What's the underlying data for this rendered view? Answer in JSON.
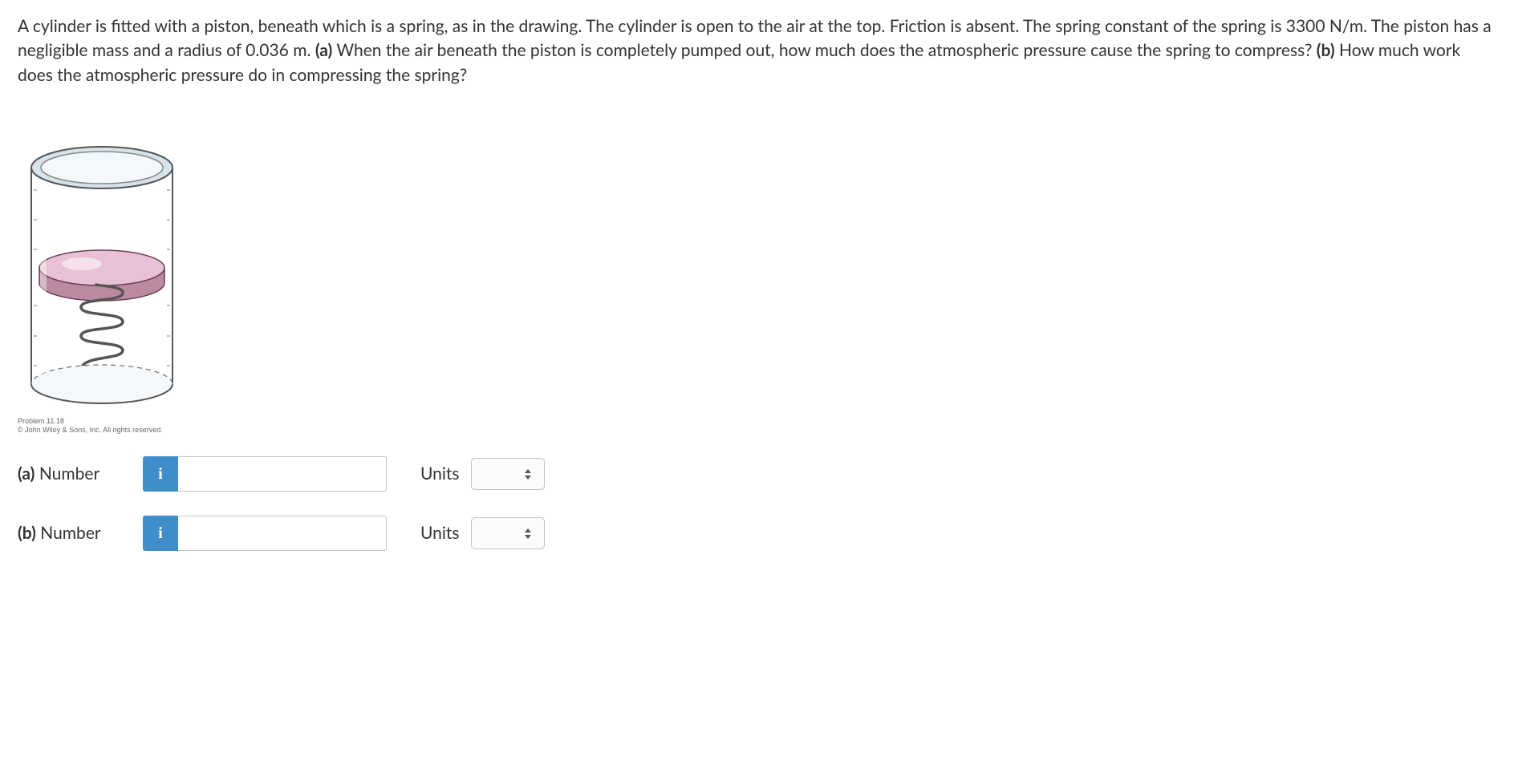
{
  "problem": {
    "text_pre_a": "A cylinder is fitted with a piston, beneath which is a spring, as in the drawing. The cylinder is open to the air at the top. Friction is absent. The spring constant of the spring is 3300 N/m. The piston has a negligible mass and a radius of 0.036 m. ",
    "label_a": "(a)",
    "text_a": " When the air beneath the piston is completely pumped out, how much does the atmospheric pressure cause the spring to compress? ",
    "label_b": "(b)",
    "text_b": " How much work does the atmospheric pressure do in compressing the spring?"
  },
  "figure": {
    "copyright_line1": "Problem 11.18",
    "copyright_line2": "© John Wiley & Sons, Inc. All rights reserved."
  },
  "answers": {
    "a": {
      "part": "(a)",
      "label": " Number",
      "info": "i",
      "value": "",
      "units_label": "Units",
      "units_value": ""
    },
    "b": {
      "part": "(b)",
      "label": " Number",
      "info": "i",
      "value": "",
      "units_label": "Units",
      "units_value": ""
    }
  }
}
